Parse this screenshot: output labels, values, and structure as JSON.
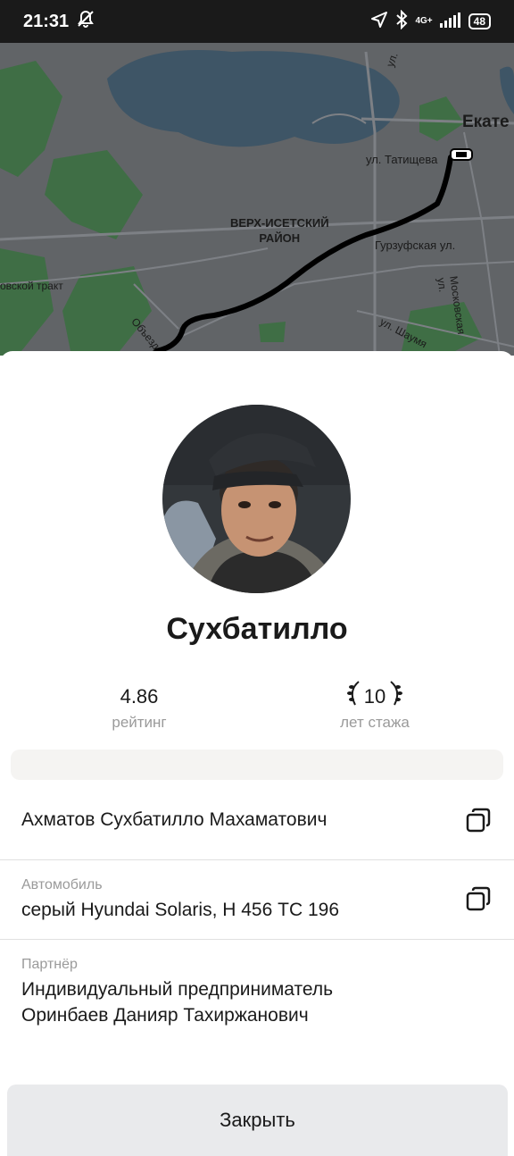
{
  "status_bar": {
    "time": "21:31",
    "network": "4G+",
    "battery": "48"
  },
  "map": {
    "labels": {
      "street_1": "ул. Татищева",
      "district": "ВЕРХ-ИСЕТСКИЙ\nРАЙОН",
      "street_2": "Гурзуфская ул.",
      "street_3": "Московская ул.",
      "street_4": "ул. Шаумя",
      "street_5": "овской тракт",
      "street_6": "Объезд",
      "city": "Екате",
      "street_7": "ул."
    }
  },
  "driver": {
    "name": "Сухбатилло",
    "rating": "4.86",
    "rating_label": "рейтинг",
    "experience": "10",
    "experience_label": "лет стажа"
  },
  "details": {
    "full_name": "Ахматов Сухбатилло Махаматович",
    "car_label": "Автомобиль",
    "car_value": "серый Hyundai Solaris, Н 456 ТС 196",
    "partner_label": "Партнёр",
    "partner_line1": "Индивидуальный предприниматель",
    "partner_line2": "Оринбаев Данияр Тахиржанович"
  },
  "close_button": "Закрыть"
}
